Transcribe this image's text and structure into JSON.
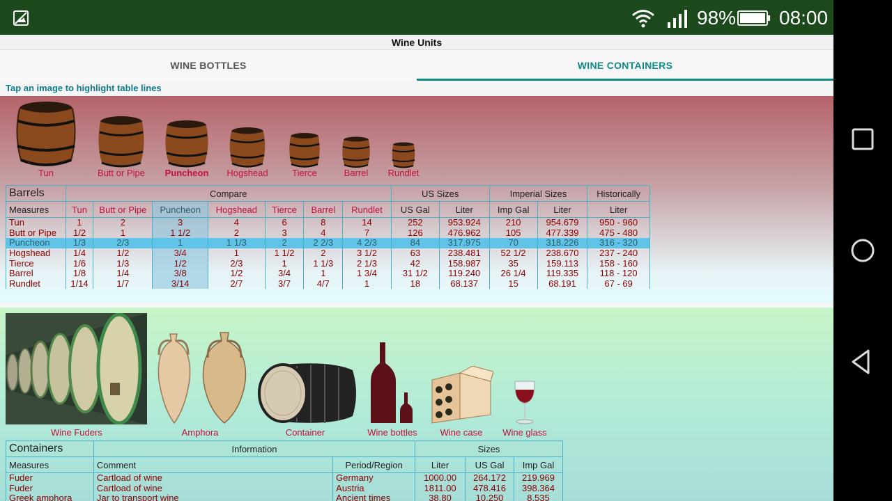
{
  "status": {
    "battery_pct": "98%",
    "time": "08:00"
  },
  "app": {
    "title": "Wine Units"
  },
  "tabs": [
    {
      "label": "WINE BOTTLES"
    },
    {
      "label": "WINE CONTAINERS"
    }
  ],
  "hint": "Tap an image to highlight table lines",
  "barrel_images": [
    "Tun",
    "Butt or Pipe",
    "Puncheon",
    "Hogshead",
    "Tierce",
    "Barrel",
    "Rundlet"
  ],
  "barrels_table": {
    "group_headers": {
      "barrels": "Barrels",
      "compare": "Compare",
      "us": "US Sizes",
      "imperial": "Imperial Sizes",
      "historic": "Historically"
    },
    "columns": [
      "Measures",
      "Tun",
      "Butt or Pipe",
      "Puncheon",
      "Hogshead",
      "Tierce",
      "Barrel",
      "Rundlet",
      "US Gal",
      "Liter",
      "Imp Gal",
      "Liter",
      "Liter"
    ],
    "rows": [
      [
        "Tun",
        "1",
        "2",
        "3",
        "4",
        "6",
        "8",
        "14",
        "252",
        "953.924",
        "210",
        "954.679",
        "950 - 960"
      ],
      [
        "Butt or Pipe",
        "1/2",
        "1",
        "1 1/2",
        "2",
        "3",
        "4",
        "7",
        "126",
        "476.962",
        "105",
        "477.339",
        "475 - 480"
      ],
      [
        "Puncheon",
        "1/3",
        "2/3",
        "1",
        "1 1/3",
        "2",
        "2 2/3",
        "4 2/3",
        "84",
        "317.975",
        "70",
        "318.226",
        "316 - 320"
      ],
      [
        "Hogshead",
        "1/4",
        "1/2",
        "3/4",
        "1",
        "1 1/2",
        "2",
        "3 1/2",
        "63",
        "238.481",
        "52 1/2",
        "238.670",
        "237 - 240"
      ],
      [
        "Tierce",
        "1/6",
        "1/3",
        "1/2",
        "2/3",
        "1",
        "1 1/3",
        "2 1/3",
        "42",
        "158.987",
        "35",
        "159.113",
        "158 - 160"
      ],
      [
        "Barrel",
        "1/8",
        "1/4",
        "3/8",
        "1/2",
        "3/4",
        "1",
        "1 3/4",
        "31 1/2",
        "119.240",
        "26 1/4",
        "119.335",
        "118 - 120"
      ],
      [
        "Rundlet",
        "1/14",
        "1/7",
        "3/14",
        "2/7",
        "3/7",
        "4/7",
        "1",
        "18",
        "68.137",
        "15",
        "68.191",
        "67 - 69"
      ]
    ]
  },
  "container_images": [
    "Wine Fuders",
    "Amphora",
    "Container",
    "Wine bottles",
    "Wine case",
    "Wine glass"
  ],
  "containers_table": {
    "group_headers": {
      "containers": "Containers",
      "info": "Information",
      "sizes": "Sizes"
    },
    "columns": [
      "Measures",
      "Comment",
      "Period/Region",
      "Liter",
      "US Gal",
      "Imp Gal"
    ],
    "rows": [
      [
        "Fuder",
        "Cartload of wine",
        "Germany",
        "1000.00",
        "264.172",
        "219.969"
      ],
      [
        "Fuder",
        "Cartload of wine",
        "Austria",
        "1811.00",
        "478.416",
        "398.364"
      ],
      [
        "Greek amphora",
        "Jar to transport wine",
        "Ancient times",
        "38.80",
        "10.250",
        "8.535"
      ]
    ]
  }
}
